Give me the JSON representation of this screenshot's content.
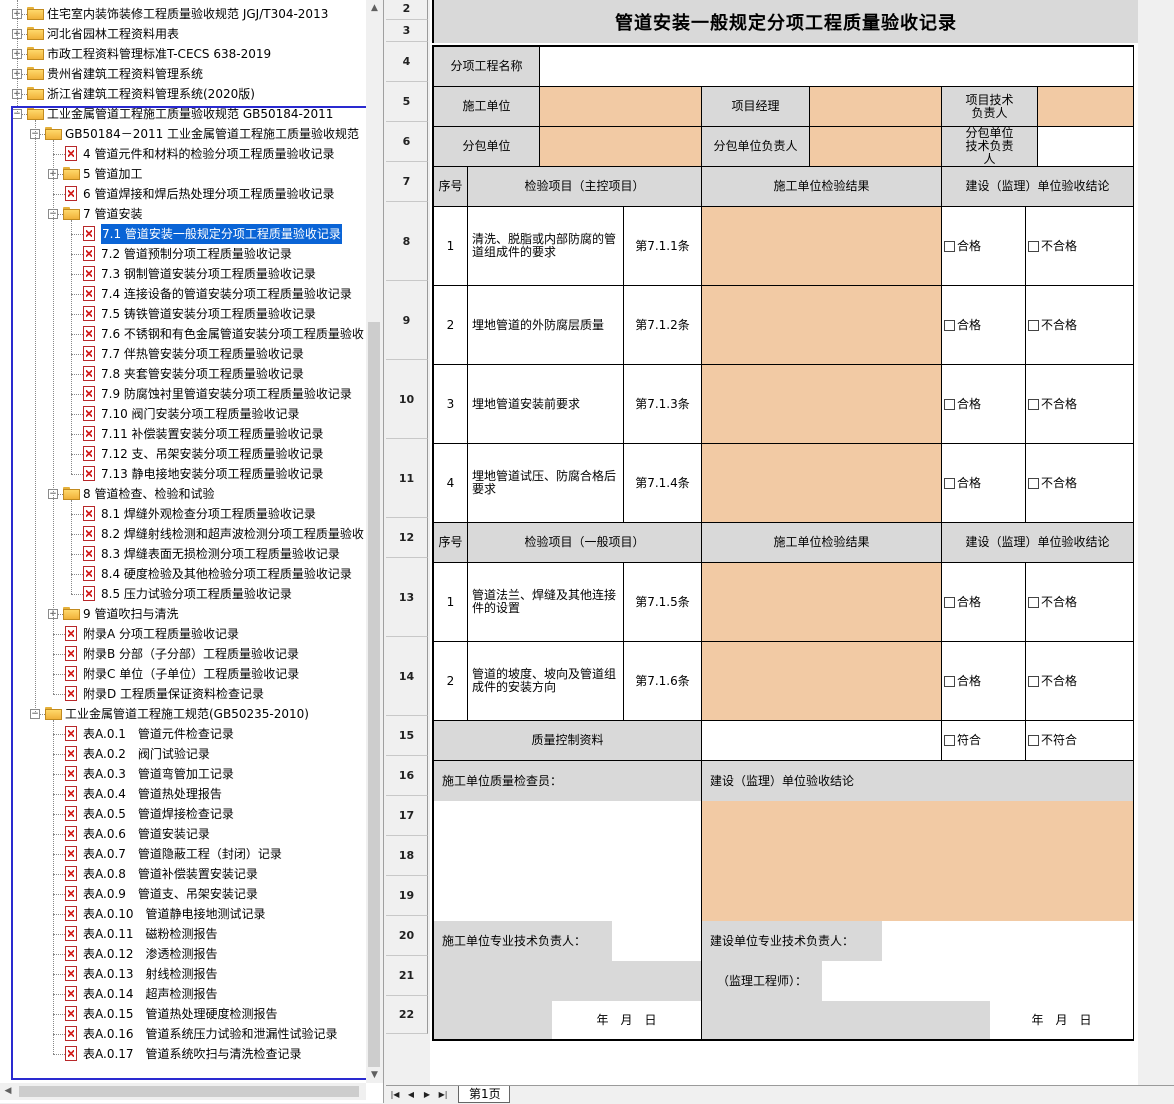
{
  "tree": {
    "rows": [
      {
        "depth": 0,
        "kind": "folder",
        "expand": "+",
        "label": "住宅室内装饰装修工程质量验收规范 JGJ/T304-2013"
      },
      {
        "depth": 0,
        "kind": "folder",
        "expand": "+",
        "label": "河北省园林工程资料用表"
      },
      {
        "depth": 0,
        "kind": "folder",
        "expand": "+",
        "label": "市政工程资料管理标准T-CECS 638-2019"
      },
      {
        "depth": 0,
        "kind": "folder",
        "expand": "+",
        "label": "贵州省建筑工程资料管理系统"
      },
      {
        "depth": 0,
        "kind": "folder",
        "expand": "+",
        "label": "浙江省建筑工程资料管理系统(2020版)"
      },
      {
        "depth": 0,
        "kind": "folder",
        "expand": "-",
        "label": "工业金属管道工程施工质量验收规范 GB50184-2011"
      },
      {
        "depth": 1,
        "kind": "folder",
        "expand": "-",
        "label": "GB50184－2011 工业金属管道工程施工质量验收规范"
      },
      {
        "depth": 2,
        "kind": "doc",
        "expand": "",
        "label": "4 管道元件和材料的检验分项工程质量验收记录"
      },
      {
        "depth": 2,
        "kind": "folder",
        "expand": "+",
        "label": "5 管道加工"
      },
      {
        "depth": 2,
        "kind": "doc",
        "expand": "",
        "label": "6 管道焊接和焊后热处理分项工程质量验收记录"
      },
      {
        "depth": 2,
        "kind": "folder",
        "expand": "-",
        "label": "7 管道安装"
      },
      {
        "depth": 3,
        "kind": "doc",
        "expand": "",
        "label": "7.1 管道安装一般规定分项工程质量验收记录",
        "selected": true
      },
      {
        "depth": 3,
        "kind": "doc",
        "expand": "",
        "label": "7.2 管道预制分项工程质量验收记录"
      },
      {
        "depth": 3,
        "kind": "doc",
        "expand": "",
        "label": "7.3 钢制管道安装分项工程质量验收记录"
      },
      {
        "depth": 3,
        "kind": "doc",
        "expand": "",
        "label": "7.4 连接设备的管道安装分项工程质量验收记录"
      },
      {
        "depth": 3,
        "kind": "doc",
        "expand": "",
        "label": "7.5 铸铁管道安装分项工程质量验收记录"
      },
      {
        "depth": 3,
        "kind": "doc",
        "expand": "",
        "label": "7.6 不锈钢和有色金属管道安装分项工程质量验收"
      },
      {
        "depth": 3,
        "kind": "doc",
        "expand": "",
        "label": "7.7 伴热管安装分项工程质量验收记录"
      },
      {
        "depth": 3,
        "kind": "doc",
        "expand": "",
        "label": "7.8 夹套管安装分项工程质量验收记录"
      },
      {
        "depth": 3,
        "kind": "doc",
        "expand": "",
        "label": "7.9 防腐蚀衬里管道安装分项工程质量验收记录"
      },
      {
        "depth": 3,
        "kind": "doc",
        "expand": "",
        "label": "7.10 阀门安装分项工程质量验收记录"
      },
      {
        "depth": 3,
        "kind": "doc",
        "expand": "",
        "label": "7.11 补偿装置安装分项工程质量验收记录"
      },
      {
        "depth": 3,
        "kind": "doc",
        "expand": "",
        "label": "7.12 支、吊架安装分项工程质量验收记录"
      },
      {
        "depth": 3,
        "kind": "doc",
        "expand": "",
        "label": "7.13 静电接地安装分项工程质量验收记录"
      },
      {
        "depth": 2,
        "kind": "folder",
        "expand": "-",
        "label": "8 管道检查、检验和试验"
      },
      {
        "depth": 3,
        "kind": "doc",
        "expand": "",
        "label": "8.1 焊缝外观检查分项工程质量验收记录"
      },
      {
        "depth": 3,
        "kind": "doc",
        "expand": "",
        "label": "8.2 焊缝射线检测和超声波检测分项工程质量验收"
      },
      {
        "depth": 3,
        "kind": "doc",
        "expand": "",
        "label": "8.3 焊缝表面无损检测分项工程质量验收记录"
      },
      {
        "depth": 3,
        "kind": "doc",
        "expand": "",
        "label": "8.4 硬度检验及其他检验分项工程质量验收记录"
      },
      {
        "depth": 3,
        "kind": "doc",
        "expand": "",
        "label": "8.5 压力试验分项工程质量验收记录"
      },
      {
        "depth": 2,
        "kind": "folder",
        "expand": "+",
        "label": "9 管道吹扫与清洗"
      },
      {
        "depth": 2,
        "kind": "doc",
        "expand": "",
        "label": "附录A 分项工程质量验收记录"
      },
      {
        "depth": 2,
        "kind": "doc",
        "expand": "",
        "label": "附录B 分部（子分部）工程质量验收记录"
      },
      {
        "depth": 2,
        "kind": "doc",
        "expand": "",
        "label": "附录C 单位（子单位）工程质量验收记录"
      },
      {
        "depth": 2,
        "kind": "doc",
        "expand": "",
        "label": "附录D 工程质量保证资料检查记录"
      },
      {
        "depth": 1,
        "kind": "folder",
        "expand": "-",
        "label": "工业金属管道工程施工规范(GB50235-2010)"
      },
      {
        "depth": 2,
        "kind": "doc",
        "expand": "",
        "label": "表A.0.1　管道元件检查记录"
      },
      {
        "depth": 2,
        "kind": "doc",
        "expand": "",
        "label": "表A.0.2　阀门试验记录"
      },
      {
        "depth": 2,
        "kind": "doc",
        "expand": "",
        "label": "表A.0.3　管道弯管加工记录"
      },
      {
        "depth": 2,
        "kind": "doc",
        "expand": "",
        "label": "表A.0.4　管道热处理报告"
      },
      {
        "depth": 2,
        "kind": "doc",
        "expand": "",
        "label": "表A.0.5　管道焊接检查记录"
      },
      {
        "depth": 2,
        "kind": "doc",
        "expand": "",
        "label": "表A.0.6　管道安装记录"
      },
      {
        "depth": 2,
        "kind": "doc",
        "expand": "",
        "label": "表A.0.7　管道隐蔽工程（封闭）记录"
      },
      {
        "depth": 2,
        "kind": "doc",
        "expand": "",
        "label": "表A.0.8　管道补偿装置安装记录"
      },
      {
        "depth": 2,
        "kind": "doc",
        "expand": "",
        "label": "表A.0.9　管道支、吊架安装记录"
      },
      {
        "depth": 2,
        "kind": "doc",
        "expand": "",
        "label": "表A.0.10　管道静电接地测试记录"
      },
      {
        "depth": 2,
        "kind": "doc",
        "expand": "",
        "label": "表A.0.11　磁粉检测报告"
      },
      {
        "depth": 2,
        "kind": "doc",
        "expand": "",
        "label": "表A.0.12　渗透检测报告"
      },
      {
        "depth": 2,
        "kind": "doc",
        "expand": "",
        "label": "表A.0.13　射线检测报告"
      },
      {
        "depth": 2,
        "kind": "doc",
        "expand": "",
        "label": "表A.0.14　超声检测报告"
      },
      {
        "depth": 2,
        "kind": "doc",
        "expand": "",
        "label": "表A.0.15　管道热处理硬度检测报告"
      },
      {
        "depth": 2,
        "kind": "doc",
        "expand": "",
        "label": "表A.0.16　管道系统压力试验和泄漏性试验记录"
      },
      {
        "depth": 2,
        "kind": "doc",
        "expand": "",
        "label": "表A.0.17　管道系统吹扫与清洗检查记录"
      }
    ]
  },
  "sheet": {
    "row_numbers": [
      "2",
      "3",
      "4",
      "5",
      "6",
      "7",
      "8",
      "9",
      "10",
      "11",
      "12",
      "13",
      "14",
      "15",
      "16",
      "17",
      "18",
      "19",
      "20",
      "21",
      "22"
    ],
    "title": "管道安装一般规定分项工程质量验收记录",
    "labels": {
      "project_name": "分项工程名称",
      "construction_unit": "施工单位",
      "project_manager": "项目经理",
      "tech_lead": "项目技术负责人",
      "subcontractor": "分包单位",
      "sub_lead": "分包单位负责人",
      "sub_tech_lead": "分包单位技术负责人",
      "seq": "序号",
      "main_items": "检验项目（主控项目）",
      "general_items": "检验项目（一般项目）",
      "result": "施工单位检验结果",
      "conclusion": "建设（监理）单位验收结论",
      "qc_docs": "质量控制资料",
      "qc_inspector": "施工单位质量检查员：",
      "supervisor_conclusion": "建设（监理）单位验收结论",
      "construction_tech": "施工单位专业技术负责人：",
      "owner_tech": "建设单位专业技术负责人：",
      "supervisor_engineer": "（监理工程师）：",
      "date": "年　月　日"
    },
    "main_items": [
      {
        "no": "1",
        "item": "清洗、脱脂或内部防腐的管道组成件的要求",
        "clause": "第7.1.1条"
      },
      {
        "no": "2",
        "item": "埋地管道的外防腐层质量",
        "clause": "第7.1.2条"
      },
      {
        "no": "3",
        "item": "埋地管道安装前要求",
        "clause": "第7.1.3条"
      },
      {
        "no": "4",
        "item": "埋地管道试压、防腐合格后要求",
        "clause": "第7.1.4条"
      }
    ],
    "general_items": [
      {
        "no": "1",
        "item": "管道法兰、焊缝及其他连接件的设置",
        "clause": "第7.1.5条"
      },
      {
        "no": "2",
        "item": "管道的坡度、坡向及管道组成件的安装方向",
        "clause": "第7.1.6条"
      }
    ],
    "pass": "合格",
    "fail": "不合格",
    "conform": "符合",
    "nonconform": "不符合",
    "colors": {
      "orange": "#f2caa4",
      "grey": "#d9d9d9"
    }
  },
  "tabs": {
    "sheet1": "第1页"
  }
}
